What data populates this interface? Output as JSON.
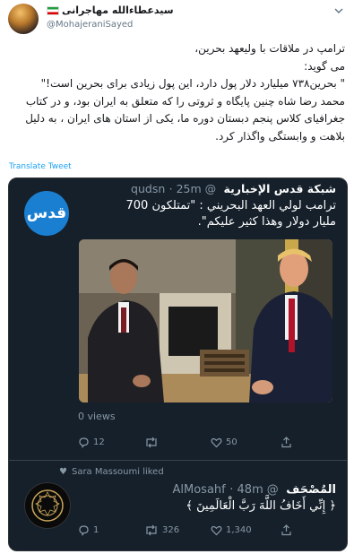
{
  "author": {
    "name": "سیدعطاءالله مهاجرانی",
    "handle": "@MohajeraniSayed"
  },
  "tweet": {
    "lines": [
      "ترامپ در ملاقات با ولیعهد بحرین،",
      "می گوید:",
      "\" بحرین۷۳۸ میلیارد دلار پول دارد، این پول زیادی برای بحرین است!\"",
      "محمد رضا شاه  چنین پایگاه و ثروتی را که متعلق به ایران بود، و در کتاب",
      "جغرافیای کلاس پنجم دبستان دوره ما، یکی از استان های ایران ، به دلیل",
      "بلاهت و وابستگی واگذار کرد."
    ],
    "translate_label": "Translate Tweet"
  },
  "quoted": {
    "logo_text": "قدس",
    "name": "شبكة قدس الإخبارية",
    "handle": "@qudsn",
    "time": "· 25m",
    "text_line1": "ترامب لولي العهد البحريني : \"تمتلكون 700",
    "text_line2": "مليار دولار وهذا كثير عليكم\".",
    "views": "0 views",
    "reply_count": "12",
    "retweet_count": "",
    "like_count": "50"
  },
  "liked_by": "Sara Massoumi liked",
  "second": {
    "name": "المُصْحَف",
    "handle": "@AlMosahf",
    "time": "· 48m",
    "text": "﴿ إِنِّي أَخَافُ اللَّهَ رَبَّ الْعَالَمِينَ ﴾",
    "reply_count": "1",
    "retweet_count": "326",
    "like_count": "1,340"
  },
  "colors": {
    "link": "#1da1f2",
    "card_bg": "#15202b",
    "muted": "#8899a6",
    "quds_blue": "#1b7fd1"
  }
}
